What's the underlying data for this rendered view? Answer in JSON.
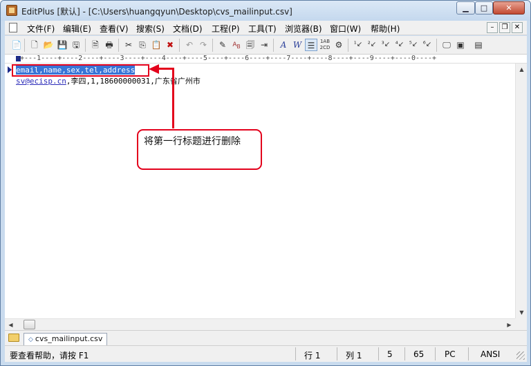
{
  "window": {
    "title": "EditPlus [默认] - [C:\\Users\\huangqyun\\Desktop\\cvs_mailinput.csv]",
    "min_glyph": "▁",
    "max_glyph": "□",
    "close_glyph": "✕"
  },
  "menu": {
    "items": [
      "文件(F)",
      "编辑(E)",
      "查看(V)",
      "搜索(S)",
      "文档(D)",
      "工程(P)",
      "工具(T)",
      "浏览器(B)",
      "窗口(W)",
      "帮助(H)"
    ],
    "mdi_min": "–",
    "mdi_restore": "❐",
    "mdi_close": "✕"
  },
  "toolbar": {
    "buttons": [
      "new-file-icon",
      "new-html-icon",
      "open-icon",
      "save-icon",
      "save-all-icon",
      "print-preview-icon",
      "print-icon",
      "cut-icon",
      "copy-icon",
      "paste-icon",
      "delete-icon",
      "undo-icon",
      "redo-icon",
      "highlight-icon",
      "replace-icon",
      "clipboard-icon",
      "indent-icon",
      "font-icon",
      "word-wrap-icon",
      "line-wrap-icon",
      "line-number-icon",
      "settings-icon",
      "tool1-icon",
      "tool2-icon",
      "tool3-icon",
      "tool4-icon",
      "tool5-icon",
      "tool6-icon",
      "browser-icon",
      "view-icon",
      "extra-icon"
    ]
  },
  "ruler": {
    "text": "-+---1----+----2----+----3----+----4----+----5----+----6----+----7----+----8----+----9----+----0----+"
  },
  "editor": {
    "line1": "email,name,sex,tel,address",
    "line2_link": "sv@ecisp.cn",
    "line2_rest": ",李四,1,18600000031,广东省广州市"
  },
  "annotation": {
    "callout_text": "将第一行标题进行删除",
    "color": "#e3001b"
  },
  "tabs": {
    "active": "cvs_mailinput.csv"
  },
  "status": {
    "help": "要查看帮助，请按 F1",
    "row_label": "行 1",
    "col_label": "列 1",
    "sel_count": "5",
    "char_count": "65",
    "line_ending": "PC",
    "encoding": "ANSI"
  },
  "colors": {
    "selection": "#3875d7",
    "accent": "#e3001b",
    "link": "#2a2ab8"
  }
}
